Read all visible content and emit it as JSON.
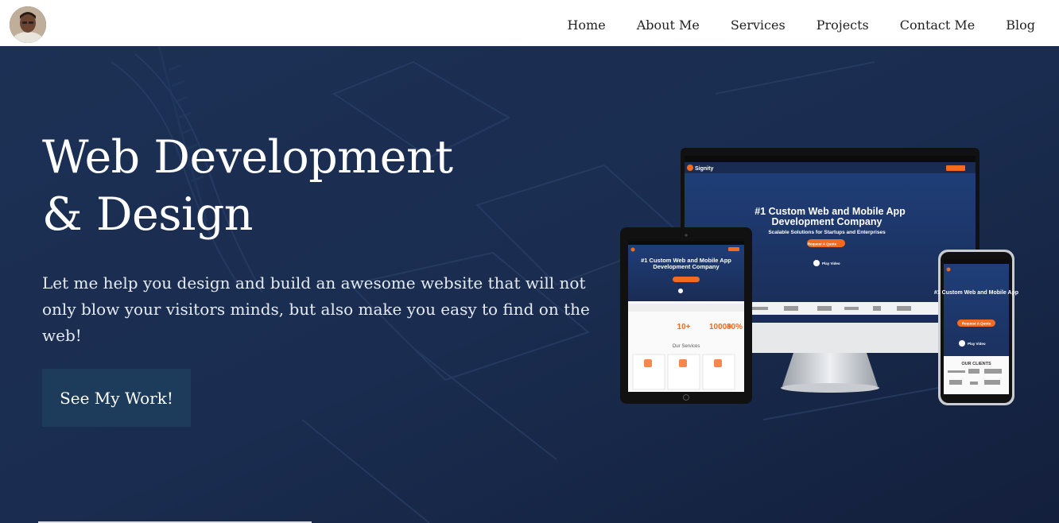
{
  "nav": {
    "items": [
      {
        "label": "Home"
      },
      {
        "label": "About Me"
      },
      {
        "label": "Services"
      },
      {
        "label": "Projects"
      },
      {
        "label": "Contact Me"
      },
      {
        "label": "Blog"
      }
    ]
  },
  "hero": {
    "title_line1": "Web Development",
    "title_line2": "& Design",
    "subtitle": "Let me help you design and build an awesome website that will not only blow your visitors minds, but also make you easy to find on the web!",
    "cta_label": "See My Work!"
  },
  "mockup": {
    "brand": "Signity",
    "headline_1": "#1 Custom Web and Mobile App",
    "headline_2": "Development Company",
    "tagline": "Scalable Solutions for Startups and Enterprises",
    "quote_btn": "Request A Quote",
    "play": "Play Video",
    "services_heading": "Our Services",
    "clients_heading": "OUR CLIENTS",
    "stats": [
      "10+",
      "1000+",
      "80%"
    ]
  },
  "colors": {
    "hero_bg": "#17284a",
    "cta_bg": "#1d3c5b",
    "accent": "#f26b21"
  }
}
